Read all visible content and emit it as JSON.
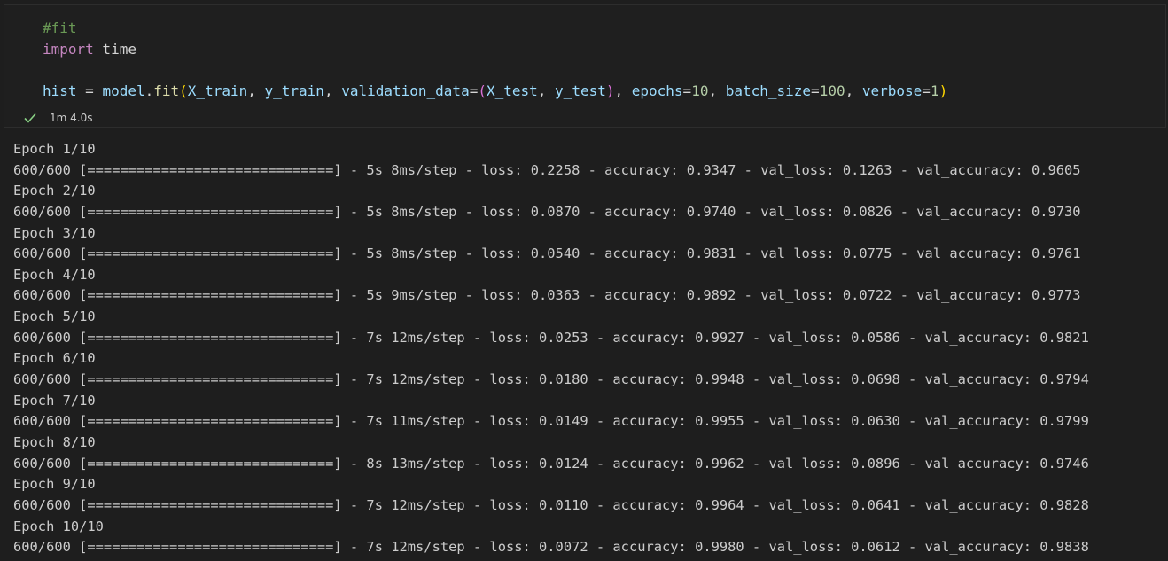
{
  "cell": {
    "code_lines": [
      [
        {
          "t": "#fit",
          "c": "comment"
        }
      ],
      [
        {
          "t": "import",
          "c": "keyword"
        },
        {
          "t": " time",
          "c": "plain"
        }
      ],
      [],
      [
        {
          "t": "hist",
          "c": "var"
        },
        {
          "t": " = ",
          "c": "plain"
        },
        {
          "t": "model",
          "c": "var"
        },
        {
          "t": ".",
          "c": "plain"
        },
        {
          "t": "fit",
          "c": "func"
        },
        {
          "t": "(",
          "c": "paren"
        },
        {
          "t": "X_train",
          "c": "var"
        },
        {
          "t": ", ",
          "c": "plain"
        },
        {
          "t": "y_train",
          "c": "var"
        },
        {
          "t": ", ",
          "c": "plain"
        },
        {
          "t": "validation_data",
          "c": "var"
        },
        {
          "t": "=",
          "c": "plain"
        },
        {
          "t": "(",
          "c": "paren2"
        },
        {
          "t": "X_test",
          "c": "var"
        },
        {
          "t": ", ",
          "c": "plain"
        },
        {
          "t": "y_test",
          "c": "var"
        },
        {
          "t": ")",
          "c": "paren2"
        },
        {
          "t": ", ",
          "c": "plain"
        },
        {
          "t": "epochs",
          "c": "var"
        },
        {
          "t": "=",
          "c": "plain"
        },
        {
          "t": "10",
          "c": "num"
        },
        {
          "t": ", ",
          "c": "plain"
        },
        {
          "t": "batch_size",
          "c": "var"
        },
        {
          "t": "=",
          "c": "plain"
        },
        {
          "t": "100",
          "c": "num"
        },
        {
          "t": ", ",
          "c": "plain"
        },
        {
          "t": "verbose",
          "c": "var"
        },
        {
          "t": "=",
          "c": "plain"
        },
        {
          "t": "1",
          "c": "num"
        },
        {
          "t": ")",
          "c": "paren"
        }
      ]
    ],
    "status": {
      "icon": "check-icon",
      "duration": "1m 4.0s"
    }
  },
  "output": {
    "lines": [
      "Epoch 1/10",
      "600/600 [==============================] - 5s 8ms/step - loss: 0.2258 - accuracy: 0.9347 - val_loss: 0.1263 - val_accuracy: 0.9605",
      "Epoch 2/10",
      "600/600 [==============================] - 5s 8ms/step - loss: 0.0870 - accuracy: 0.9740 - val_loss: 0.0826 - val_accuracy: 0.9730",
      "Epoch 3/10",
      "600/600 [==============================] - 5s 8ms/step - loss: 0.0540 - accuracy: 0.9831 - val_loss: 0.0775 - val_accuracy: 0.9761",
      "Epoch 4/10",
      "600/600 [==============================] - 5s 9ms/step - loss: 0.0363 - accuracy: 0.9892 - val_loss: 0.0722 - val_accuracy: 0.9773",
      "Epoch 5/10",
      "600/600 [==============================] - 7s 12ms/step - loss: 0.0253 - accuracy: 0.9927 - val_loss: 0.0586 - val_accuracy: 0.9821",
      "Epoch 6/10",
      "600/600 [==============================] - 7s 12ms/step - loss: 0.0180 - accuracy: 0.9948 - val_loss: 0.0698 - val_accuracy: 0.9794",
      "Epoch 7/10",
      "600/600 [==============================] - 7s 11ms/step - loss: 0.0149 - accuracy: 0.9955 - val_loss: 0.0630 - val_accuracy: 0.9799",
      "Epoch 8/10",
      "600/600 [==============================] - 8s 13ms/step - loss: 0.0124 - accuracy: 0.9962 - val_loss: 0.0896 - val_accuracy: 0.9746",
      "Epoch 9/10",
      "600/600 [==============================] - 7s 12ms/step - loss: 0.0110 - accuracy: 0.9964 - val_loss: 0.0641 - val_accuracy: 0.9828",
      "Epoch 10/10",
      "600/600 [==============================] - 7s 12ms/step - loss: 0.0072 - accuracy: 0.9980 - val_loss: 0.0612 - val_accuracy: 0.9838"
    ]
  },
  "colors": {
    "background": "#1e1e1e",
    "success": "#89d185",
    "comment": "#6a9955",
    "keyword": "#c586c0",
    "variable": "#9cdcfe",
    "function": "#dcdcaa",
    "number": "#b5cea8"
  }
}
